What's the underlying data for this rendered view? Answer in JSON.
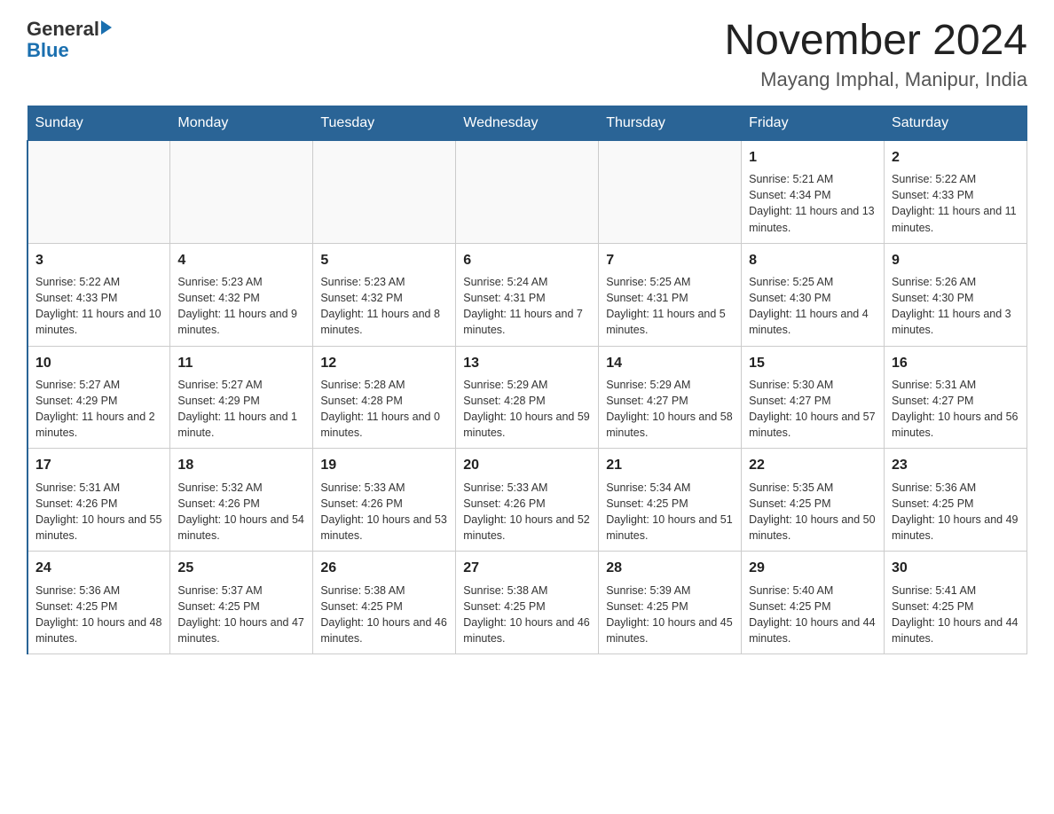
{
  "header": {
    "logo_general": "General",
    "logo_blue": "Blue",
    "title": "November 2024",
    "location": "Mayang Imphal, Manipur, India"
  },
  "weekdays": [
    "Sunday",
    "Monday",
    "Tuesday",
    "Wednesday",
    "Thursday",
    "Friday",
    "Saturday"
  ],
  "weeks": [
    [
      {
        "day": "",
        "sunrise": "",
        "sunset": "",
        "daylight": ""
      },
      {
        "day": "",
        "sunrise": "",
        "sunset": "",
        "daylight": ""
      },
      {
        "day": "",
        "sunrise": "",
        "sunset": "",
        "daylight": ""
      },
      {
        "day": "",
        "sunrise": "",
        "sunset": "",
        "daylight": ""
      },
      {
        "day": "",
        "sunrise": "",
        "sunset": "",
        "daylight": ""
      },
      {
        "day": "1",
        "sunrise": "Sunrise: 5:21 AM",
        "sunset": "Sunset: 4:34 PM",
        "daylight": "Daylight: 11 hours and 13 minutes."
      },
      {
        "day": "2",
        "sunrise": "Sunrise: 5:22 AM",
        "sunset": "Sunset: 4:33 PM",
        "daylight": "Daylight: 11 hours and 11 minutes."
      }
    ],
    [
      {
        "day": "3",
        "sunrise": "Sunrise: 5:22 AM",
        "sunset": "Sunset: 4:33 PM",
        "daylight": "Daylight: 11 hours and 10 minutes."
      },
      {
        "day": "4",
        "sunrise": "Sunrise: 5:23 AM",
        "sunset": "Sunset: 4:32 PM",
        "daylight": "Daylight: 11 hours and 9 minutes."
      },
      {
        "day": "5",
        "sunrise": "Sunrise: 5:23 AM",
        "sunset": "Sunset: 4:32 PM",
        "daylight": "Daylight: 11 hours and 8 minutes."
      },
      {
        "day": "6",
        "sunrise": "Sunrise: 5:24 AM",
        "sunset": "Sunset: 4:31 PM",
        "daylight": "Daylight: 11 hours and 7 minutes."
      },
      {
        "day": "7",
        "sunrise": "Sunrise: 5:25 AM",
        "sunset": "Sunset: 4:31 PM",
        "daylight": "Daylight: 11 hours and 5 minutes."
      },
      {
        "day": "8",
        "sunrise": "Sunrise: 5:25 AM",
        "sunset": "Sunset: 4:30 PM",
        "daylight": "Daylight: 11 hours and 4 minutes."
      },
      {
        "day": "9",
        "sunrise": "Sunrise: 5:26 AM",
        "sunset": "Sunset: 4:30 PM",
        "daylight": "Daylight: 11 hours and 3 minutes."
      }
    ],
    [
      {
        "day": "10",
        "sunrise": "Sunrise: 5:27 AM",
        "sunset": "Sunset: 4:29 PM",
        "daylight": "Daylight: 11 hours and 2 minutes."
      },
      {
        "day": "11",
        "sunrise": "Sunrise: 5:27 AM",
        "sunset": "Sunset: 4:29 PM",
        "daylight": "Daylight: 11 hours and 1 minute."
      },
      {
        "day": "12",
        "sunrise": "Sunrise: 5:28 AM",
        "sunset": "Sunset: 4:28 PM",
        "daylight": "Daylight: 11 hours and 0 minutes."
      },
      {
        "day": "13",
        "sunrise": "Sunrise: 5:29 AM",
        "sunset": "Sunset: 4:28 PM",
        "daylight": "Daylight: 10 hours and 59 minutes."
      },
      {
        "day": "14",
        "sunrise": "Sunrise: 5:29 AM",
        "sunset": "Sunset: 4:27 PM",
        "daylight": "Daylight: 10 hours and 58 minutes."
      },
      {
        "day": "15",
        "sunrise": "Sunrise: 5:30 AM",
        "sunset": "Sunset: 4:27 PM",
        "daylight": "Daylight: 10 hours and 57 minutes."
      },
      {
        "day": "16",
        "sunrise": "Sunrise: 5:31 AM",
        "sunset": "Sunset: 4:27 PM",
        "daylight": "Daylight: 10 hours and 56 minutes."
      }
    ],
    [
      {
        "day": "17",
        "sunrise": "Sunrise: 5:31 AM",
        "sunset": "Sunset: 4:26 PM",
        "daylight": "Daylight: 10 hours and 55 minutes."
      },
      {
        "day": "18",
        "sunrise": "Sunrise: 5:32 AM",
        "sunset": "Sunset: 4:26 PM",
        "daylight": "Daylight: 10 hours and 54 minutes."
      },
      {
        "day": "19",
        "sunrise": "Sunrise: 5:33 AM",
        "sunset": "Sunset: 4:26 PM",
        "daylight": "Daylight: 10 hours and 53 minutes."
      },
      {
        "day": "20",
        "sunrise": "Sunrise: 5:33 AM",
        "sunset": "Sunset: 4:26 PM",
        "daylight": "Daylight: 10 hours and 52 minutes."
      },
      {
        "day": "21",
        "sunrise": "Sunrise: 5:34 AM",
        "sunset": "Sunset: 4:25 PM",
        "daylight": "Daylight: 10 hours and 51 minutes."
      },
      {
        "day": "22",
        "sunrise": "Sunrise: 5:35 AM",
        "sunset": "Sunset: 4:25 PM",
        "daylight": "Daylight: 10 hours and 50 minutes."
      },
      {
        "day": "23",
        "sunrise": "Sunrise: 5:36 AM",
        "sunset": "Sunset: 4:25 PM",
        "daylight": "Daylight: 10 hours and 49 minutes."
      }
    ],
    [
      {
        "day": "24",
        "sunrise": "Sunrise: 5:36 AM",
        "sunset": "Sunset: 4:25 PM",
        "daylight": "Daylight: 10 hours and 48 minutes."
      },
      {
        "day": "25",
        "sunrise": "Sunrise: 5:37 AM",
        "sunset": "Sunset: 4:25 PM",
        "daylight": "Daylight: 10 hours and 47 minutes."
      },
      {
        "day": "26",
        "sunrise": "Sunrise: 5:38 AM",
        "sunset": "Sunset: 4:25 PM",
        "daylight": "Daylight: 10 hours and 46 minutes."
      },
      {
        "day": "27",
        "sunrise": "Sunrise: 5:38 AM",
        "sunset": "Sunset: 4:25 PM",
        "daylight": "Daylight: 10 hours and 46 minutes."
      },
      {
        "day": "28",
        "sunrise": "Sunrise: 5:39 AM",
        "sunset": "Sunset: 4:25 PM",
        "daylight": "Daylight: 10 hours and 45 minutes."
      },
      {
        "day": "29",
        "sunrise": "Sunrise: 5:40 AM",
        "sunset": "Sunset: 4:25 PM",
        "daylight": "Daylight: 10 hours and 44 minutes."
      },
      {
        "day": "30",
        "sunrise": "Sunrise: 5:41 AM",
        "sunset": "Sunset: 4:25 PM",
        "daylight": "Daylight: 10 hours and 44 minutes."
      }
    ]
  ]
}
